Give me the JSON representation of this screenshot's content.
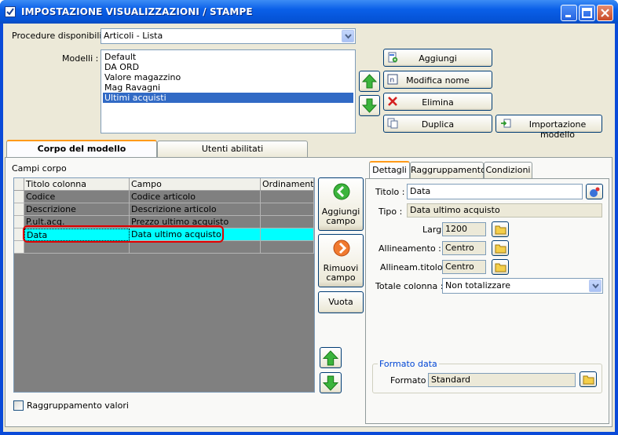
{
  "window": {
    "title": "IMPOSTAZIONE VISUALIZZAZIONI / STAMPE"
  },
  "procedure": {
    "label": "Procedure disponibili :",
    "value": "Articoli - Lista"
  },
  "modelli": {
    "label": "Modelli :",
    "items": [
      "Default",
      "DA ORD",
      "Valore magazzino",
      "Mag Ravagni",
      "Ultimi acquisti"
    ],
    "selected": "Ultimi acquisti"
  },
  "buttons": {
    "aggiungi": "Aggiungi",
    "modifica_nome": "Modifica nome",
    "elimina": "Elimina",
    "duplica": "Duplica",
    "importazione": "Importazione modello"
  },
  "tabs": {
    "corpo": "Corpo del modello",
    "utenti": "Utenti abilitati"
  },
  "campi": {
    "label": "Campi corpo",
    "columns": [
      "Titolo colonna",
      "Campo",
      "Ordinamento"
    ],
    "rows": [
      [
        "Codice",
        "Codice articolo",
        ""
      ],
      [
        "Descrizione",
        "Descrizione articolo",
        ""
      ],
      [
        "P.ult.acq.",
        "Prezzo ultimo acquisto",
        ""
      ],
      [
        "Data",
        "Data ultimo acquisto",
        ""
      ],
      [
        "",
        "",
        ""
      ]
    ],
    "highlight_color": "#00ffff"
  },
  "side": {
    "aggiungi_campo": "Aggiungi campo",
    "rimuovi_campo": "Rimuovi campo",
    "vuota": "Vuota"
  },
  "raggruppamento_valori": "Raggruppamento valori",
  "detail_tabs": {
    "dettagli": "Dettagli",
    "raggruppamento": "Raggruppamento",
    "condizioni": "Condizioni"
  },
  "dettagli": {
    "titolo_label": "Titolo :",
    "titolo_value": "Data",
    "tipo_label": "Tipo :",
    "tipo_value": "Data ultimo acquisto",
    "larg_label": "Larg. :",
    "larg_value": "1200",
    "allineamento_label": "Allineamento :",
    "allineamento_value": "Centro",
    "allineam_titolo_label": "Allineam.titolo :",
    "allineam_titolo_value": "Centro",
    "totale_label": "Totale colonna :",
    "totale_value": "Non totalizzare",
    "formato_group": "Formato data",
    "formato_label": "Formato :",
    "formato_value": "Standard"
  },
  "colors": {
    "titlebar": "#0553d6",
    "selection": "#316ac5",
    "group_title": "#0046d5",
    "red_marker": "#e00000"
  }
}
